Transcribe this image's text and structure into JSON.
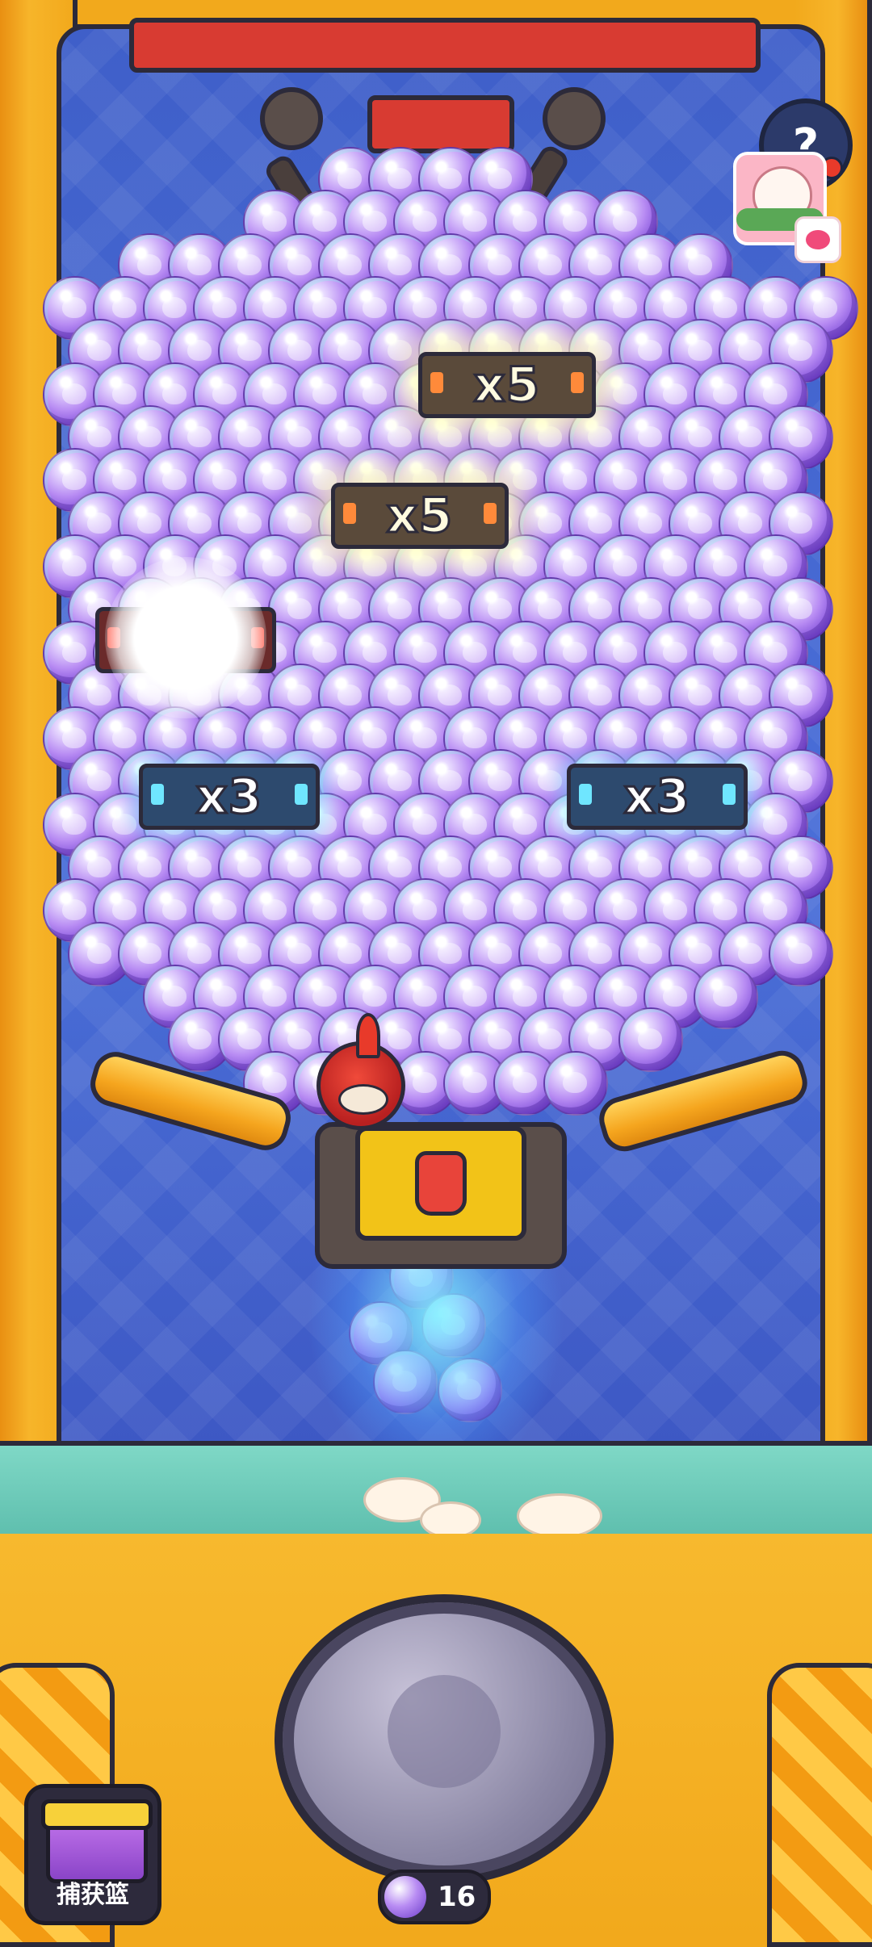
{
  "help": {
    "label": "?"
  },
  "multipliers": {
    "x5_top": "x5",
    "x5_mid": "x5",
    "left_partial": "x",
    "x3_left": "x3",
    "x3_right": "x3"
  },
  "basket": {
    "label": "捕获篮"
  },
  "counter": {
    "value": "16"
  },
  "icons": {
    "help": "question-icon",
    "avatar": "player-avatar",
    "chat": "chat-icon",
    "basket": "treasure-chest-icon",
    "counter": "paw-ball-icon"
  }
}
